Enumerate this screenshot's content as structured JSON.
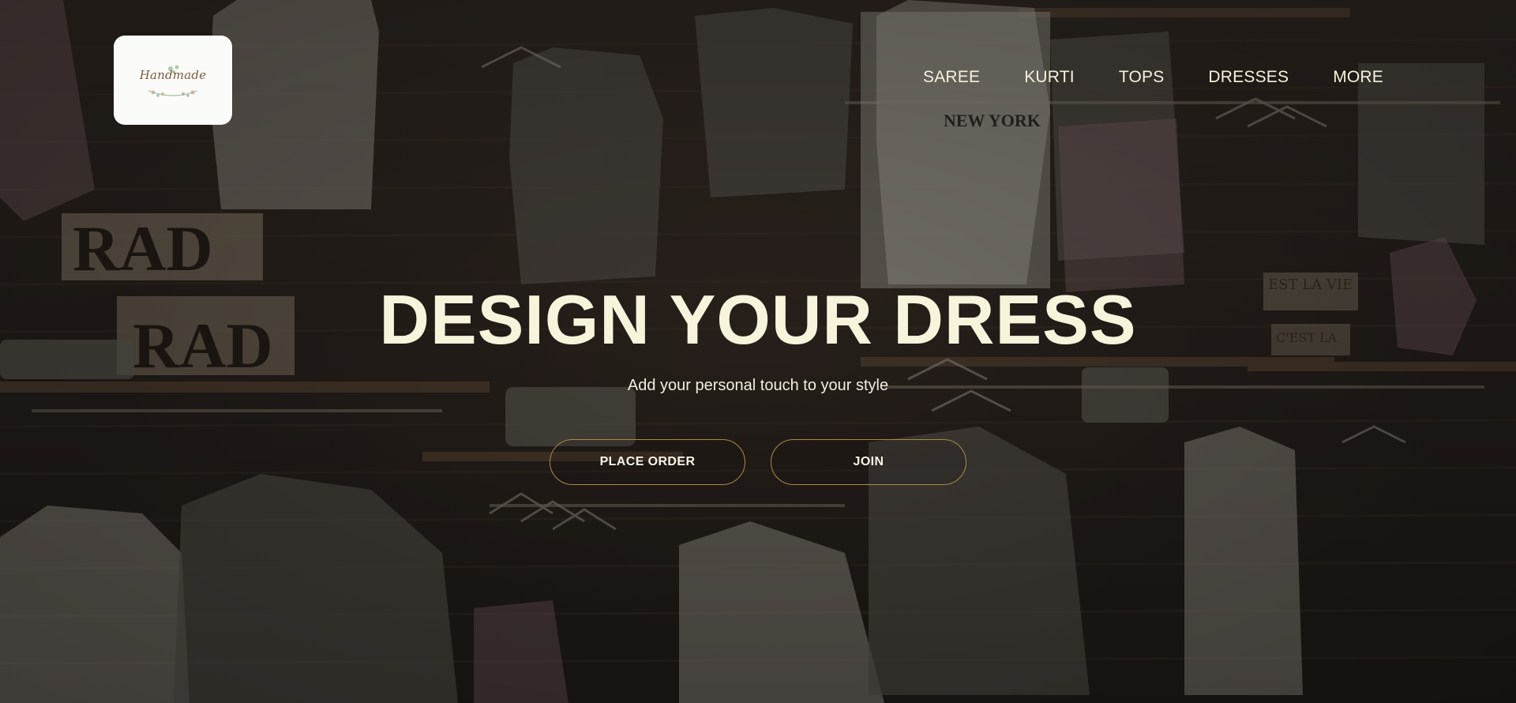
{
  "brand": {
    "logo_text": "Handmade"
  },
  "nav": {
    "items": [
      {
        "label": "SAREE"
      },
      {
        "label": "KURTI"
      },
      {
        "label": "TOPS"
      },
      {
        "label": "DRESSES"
      },
      {
        "label": "MORE"
      }
    ]
  },
  "hero": {
    "headline": "DESIGN YOUR DRESS",
    "subtitle": "Add your personal touch to your style",
    "buttons": {
      "place_order": "PLACE ORDER",
      "join": "JOIN"
    },
    "background_image_signs": [
      "RAD",
      "RAD",
      "NEW YORK",
      "EST LA VIE",
      "C'EST LA VIE"
    ]
  },
  "colors": {
    "text_primary": "#f7f4dc",
    "button_border": "#a78a46",
    "logo_bg": "#fbfbf9"
  }
}
